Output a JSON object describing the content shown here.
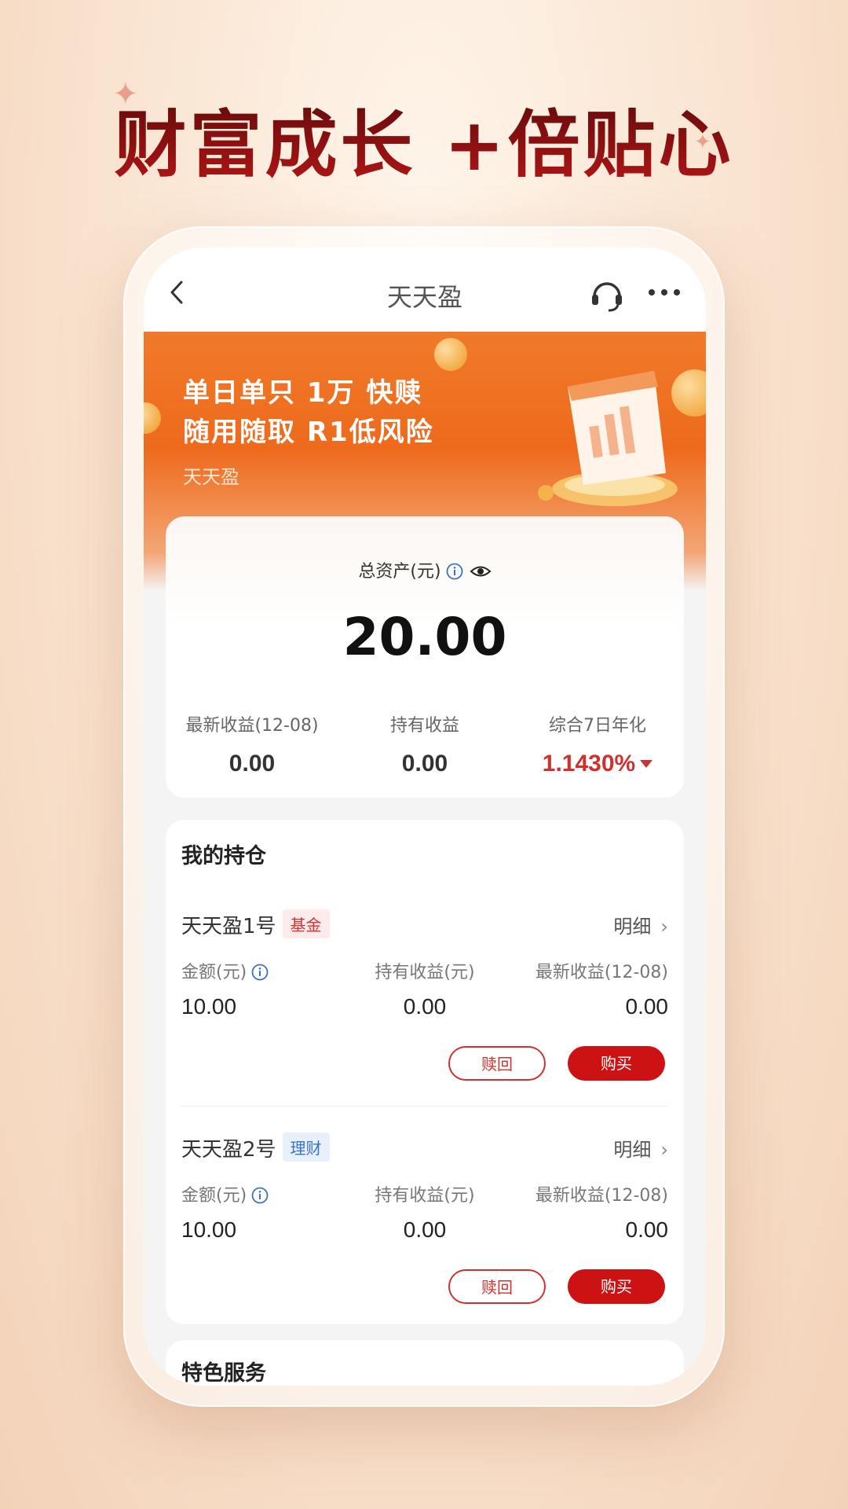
{
  "promo": {
    "headline": "财富成长 +倍贴心"
  },
  "nav": {
    "title": "天天盈",
    "icons": [
      "back-arrow-icon",
      "headset-icon",
      "more-dots-icon"
    ]
  },
  "banner": {
    "line1": "单日单只 1万 快赎",
    "line2": "随用随取 R1低风险",
    "subtitle": "天天盈"
  },
  "assets": {
    "label": "总资产(元)",
    "value": "20.00",
    "stats": [
      {
        "label": "最新收益(12-08)",
        "value": "0.00"
      },
      {
        "label": "持有收益",
        "value": "0.00"
      },
      {
        "label": "综合7日年化",
        "value": "1.1430%"
      }
    ]
  },
  "holdings": {
    "title": "我的持仓",
    "items": [
      {
        "name": "天天盈1号",
        "tag": "基金",
        "detail": "明细",
        "amount_label": "金额(元)",
        "amount": "10.00",
        "hold_label": "持有收益(元)",
        "hold": "0.00",
        "latest_label": "最新收益(12-08)",
        "latest": "0.00",
        "redeem": "赎回",
        "buy": "购买"
      },
      {
        "name": "天天盈2号",
        "tag": "理财",
        "detail": "明细",
        "amount_label": "金额(元)",
        "amount": "10.00",
        "hold_label": "持有收益(元)",
        "hold": "0.00",
        "latest_label": "最新收益(12-08)",
        "latest": "0.00",
        "redeem": "赎回",
        "buy": "购买"
      }
    ]
  },
  "services": {
    "title": "特色服务"
  },
  "colors": {
    "brand_red": "#cc1212",
    "banner_orange": "#ee6a1c",
    "rate_red": "#d0312e",
    "tag_blue": "#3a72c7"
  }
}
